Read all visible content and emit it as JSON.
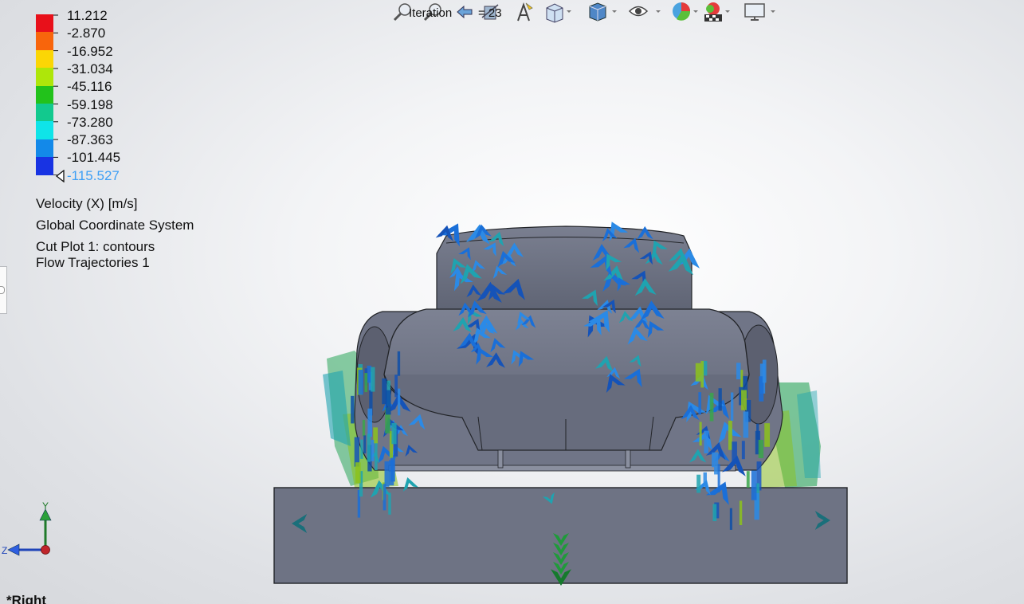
{
  "toolbar": {
    "iteration_label": "Iteration",
    "iteration_value": "= 23",
    "tools": [
      {
        "name": "zoom-to-fit-icon"
      },
      {
        "name": "zoom-to-area-icon"
      },
      {
        "name": "previous-view-icon"
      },
      {
        "name": "section-view-icon"
      },
      {
        "name": "dynamic-annotation-icon"
      },
      {
        "name": "view-orientation-icon"
      },
      {
        "name": "display-style-icon"
      },
      {
        "name": "hide-show-items-icon"
      },
      {
        "name": "edit-appearance-icon"
      },
      {
        "name": "apply-scene-icon"
      },
      {
        "name": "view-settings-icon"
      }
    ]
  },
  "legend": {
    "values": [
      "11.212",
      "-2.870",
      "-16.952",
      "-31.034",
      "-45.116",
      "-59.198",
      "-73.280",
      "-87.363",
      "-101.445",
      "-115.527"
    ],
    "colors": [
      "#e8101a",
      "#f8650c",
      "#fbd605",
      "#aee60a",
      "#22c21b",
      "#12c98e",
      "#0fe4e8",
      "#1389e9",
      "#1833e3"
    ],
    "parameter": "Velocity (X) [m/s]",
    "coordinate_system": "Global Coordinate System",
    "plots": [
      "Cut Plot 1: contours",
      "Flow Trajectories 1"
    ]
  },
  "triad": {
    "y_label": "Y",
    "z_label": "Z"
  },
  "view_name": "*Right",
  "scene": {
    "body_color": "#6e7384",
    "body_edge": "#222428",
    "arrow_colors": [
      "#1a6fd8",
      "#2b8ae6",
      "#1553b8",
      "#1fa3b0",
      "#3aa64a",
      "#8cc21c",
      "#0d4fa8"
    ]
  }
}
